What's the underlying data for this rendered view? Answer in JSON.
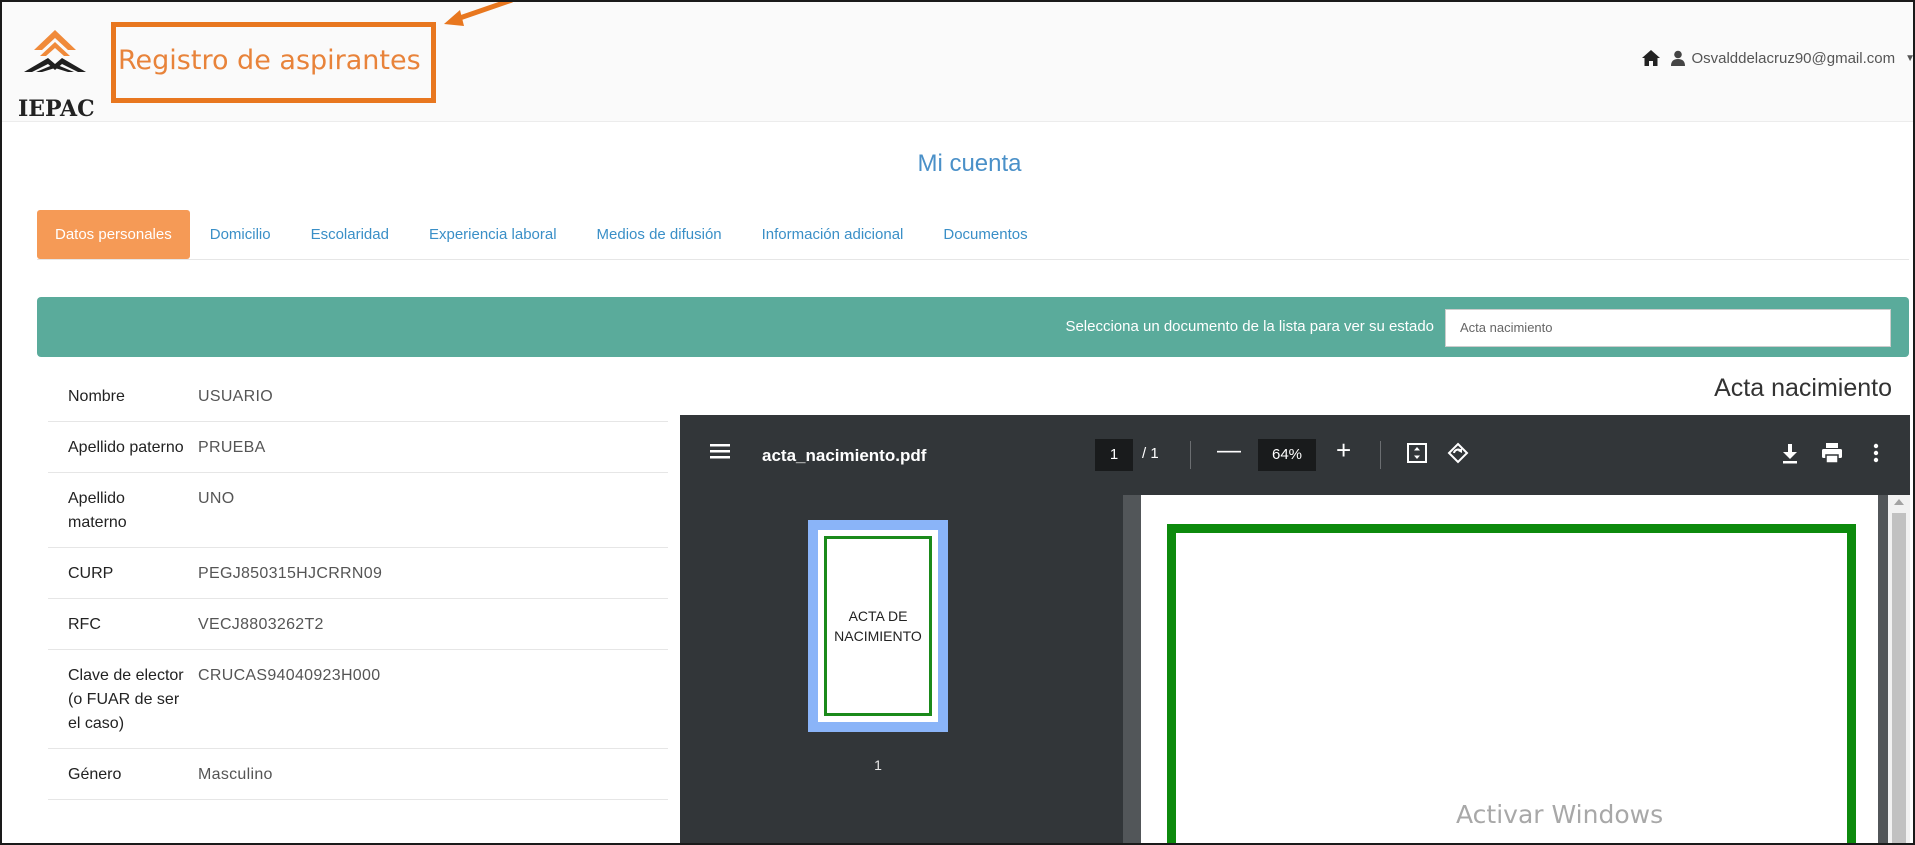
{
  "header": {
    "logo_text": "IEPAC",
    "app_title": "Registro de aspirantes",
    "user_email": "Osvalddelacruz90@gmail.com",
    "icons": {
      "home": "home-icon",
      "user": "user-icon",
      "dropdown": "caret-down-icon"
    },
    "brand_color": "#e8833a"
  },
  "account": {
    "title": "Mi cuenta"
  },
  "tabs": [
    {
      "label": "Datos personales",
      "active": true
    },
    {
      "label": "Domicilio",
      "active": false
    },
    {
      "label": "Escolaridad",
      "active": false
    },
    {
      "label": "Experiencia laboral",
      "active": false
    },
    {
      "label": "Medios de difusión",
      "active": false
    },
    {
      "label": "Información adicional",
      "active": false
    },
    {
      "label": "Documentos",
      "active": false
    }
  ],
  "document_bar": {
    "label": "Selecciona un documento de la lista para ver su estado",
    "selected": "Acta nacimiento",
    "bar_color": "#5aab9b"
  },
  "personal_data": [
    {
      "label": "Nombre",
      "value": "USUARIO"
    },
    {
      "label": "Apellido paterno",
      "value": "PRUEBA"
    },
    {
      "label": "Apellido materno",
      "value": "UNO"
    },
    {
      "label": "CURP",
      "value": "PEGJ850315HJCRRN09"
    },
    {
      "label": "RFC",
      "value": "VECJ8803262T2"
    },
    {
      "label": "Clave de elector (o FUAR de ser el caso)",
      "value": "CRUCAS94040923H000"
    },
    {
      "label": "Género",
      "value": "Masculino"
    }
  ],
  "document_view": {
    "heading": "Acta nacimiento",
    "pdf": {
      "file_name": "acta_nacimiento.pdf",
      "current_page": "1",
      "page_total": "/ 1",
      "zoom": "64%",
      "zoom_out": "—",
      "zoom_in": "+",
      "thumbnail_text": "ACTA DE NACIMIENTO",
      "thumbnail_page": "1"
    }
  },
  "watermark": "Activar Windows"
}
